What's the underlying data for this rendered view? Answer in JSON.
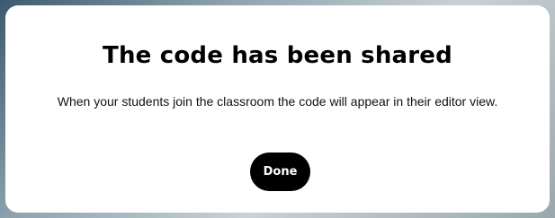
{
  "dialog": {
    "title": "The code has been shared",
    "message": "When your students join the classroom the code will appear in their editor view.",
    "done_label": "Done"
  },
  "colors": {
    "button_background": "#000000",
    "button_text": "#ffffff",
    "dialog_background": "#ffffff"
  }
}
